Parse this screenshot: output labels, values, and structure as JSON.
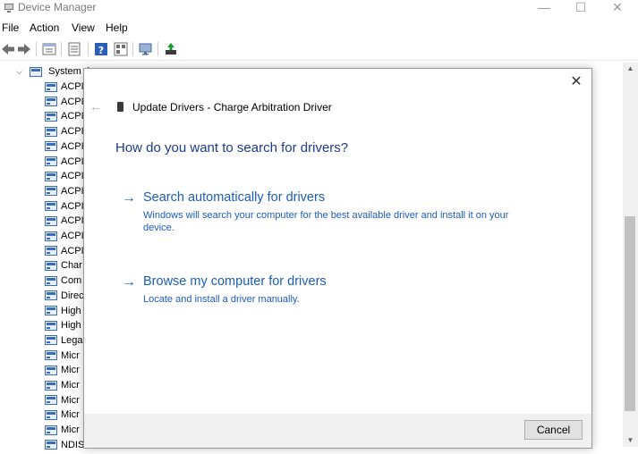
{
  "window": {
    "title": "Device Manager",
    "minimize": "—",
    "maximize": "☐",
    "close": "✕"
  },
  "menu": [
    "File",
    "Action",
    "View",
    "Help"
  ],
  "tree": {
    "root_label": "System d",
    "items": [
      "ACPI",
      "ACPI",
      "ACPI",
      "ACPI",
      "ACPI",
      "ACPI",
      "ACPI",
      "ACPI",
      "ACPI",
      "ACPI",
      "ACPI",
      "ACPI",
      "Char",
      "Com",
      "Direc",
      "High",
      "High",
      "Lega",
      "Micr",
      "Micr",
      "Micr",
      "Micr",
      "Micr",
      "Micr",
      "NDIS"
    ]
  },
  "dialog": {
    "close": "✕",
    "back": "←",
    "header": "Update Drivers - Charge Arbitration Driver",
    "question": "How do you want to search for drivers?",
    "options": [
      {
        "arrow": "→",
        "title": "Search automatically for drivers",
        "desc": "Windows will search your computer for the best available driver and install it on your device."
      },
      {
        "arrow": "→",
        "title": "Browse my computer for drivers",
        "desc": "Locate and install a driver manually."
      }
    ],
    "cancel": "Cancel"
  },
  "scrollbar": {
    "up": "▲",
    "down": "▼"
  },
  "colors": {
    "link_blue": "#1c5cb8",
    "heading_blue": "#1e3a8a",
    "footer_bg": "#f0f0f0"
  }
}
